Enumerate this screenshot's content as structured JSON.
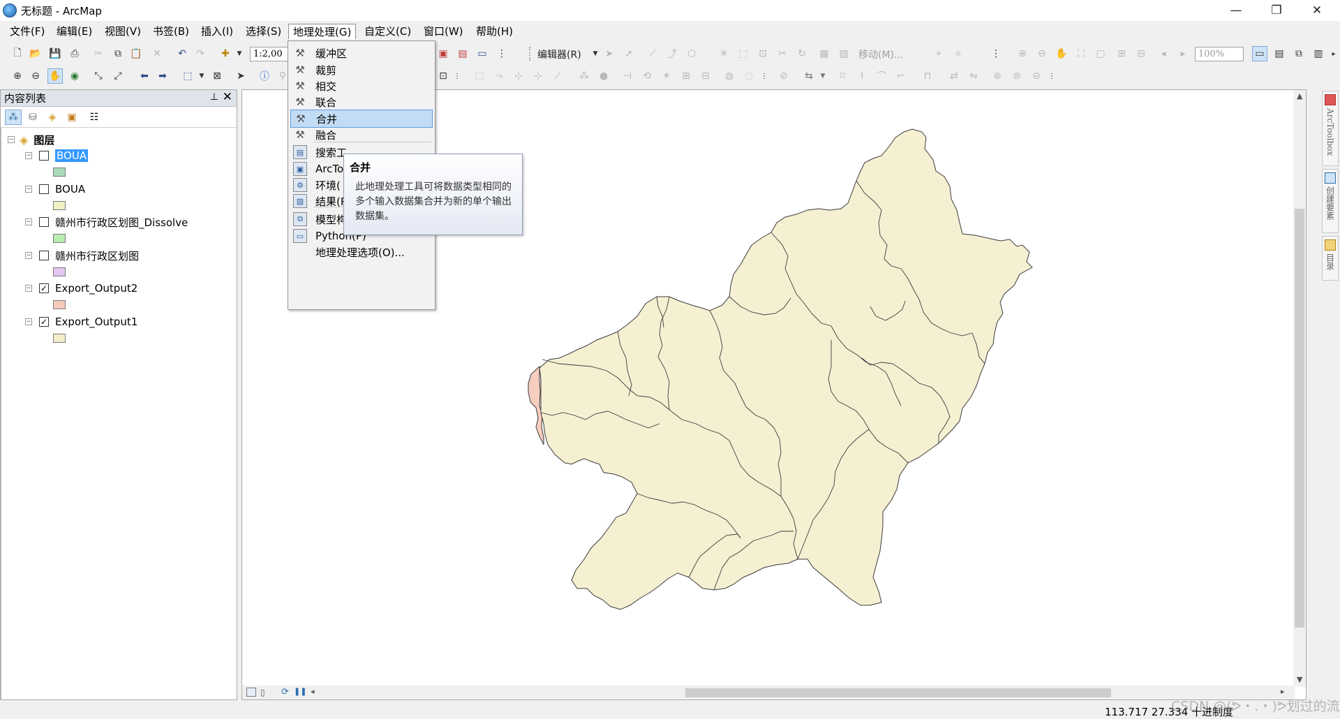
{
  "window": {
    "title": "无标题 - ArcMap",
    "controls": [
      "—",
      "❐",
      "✕"
    ]
  },
  "menubar": {
    "items": [
      "文件(F)",
      "编辑(E)",
      "视图(V)",
      "书签(B)",
      "插入(I)",
      "选择(S)",
      "地理处理(G)",
      "自定义(C)",
      "窗口(W)",
      "帮助(H)"
    ],
    "active": "地理处理(G)"
  },
  "toolbar": {
    "scale_value": "1:2,00",
    "editor_label": "编辑器(R)",
    "move_label": "移动(M)...",
    "zoom_value": "100%"
  },
  "toc": {
    "title": "内容列表",
    "root_label": "图层",
    "layers": [
      {
        "name": "BOUA",
        "checked": false,
        "selected": true,
        "color": "#a8dcb8"
      },
      {
        "name": "BOUA",
        "checked": false,
        "selected": false,
        "color": "#f1f0c6"
      },
      {
        "name": "赣州市行政区划图_Dissolve",
        "checked": false,
        "selected": false,
        "color": "#b9ecb0"
      },
      {
        "name": "赣州市行政区划图",
        "checked": false,
        "selected": false,
        "color": "#e3c6f1"
      },
      {
        "name": "Export_Output2",
        "checked": true,
        "selected": false,
        "color": "#f5cbb8"
      },
      {
        "name": "Export_Output1",
        "checked": true,
        "selected": false,
        "color": "#f5eecb"
      }
    ]
  },
  "geoprocessing_menu": {
    "items": [
      {
        "label": "缓冲区",
        "icon": "hammer-icon"
      },
      {
        "label": "裁剪",
        "icon": "hammer-icon"
      },
      {
        "label": "相交",
        "icon": "hammer-icon"
      },
      {
        "label": "联合",
        "icon": "hammer-icon"
      },
      {
        "label": "合并",
        "icon": "hammer-icon",
        "hover": true
      },
      {
        "label": "融合",
        "icon": "hammer-icon"
      },
      {
        "label": "搜索工",
        "icon": "search-window-icon"
      },
      {
        "label": "ArcTo",
        "icon": "toolbox-icon"
      },
      {
        "label": "环境(",
        "icon": "environment-icon"
      },
      {
        "label": "结果(R)",
        "icon": "results-icon"
      },
      {
        "label": "模型构建器(M)",
        "icon": "model-builder-icon"
      },
      {
        "label": "Python(P)",
        "icon": "python-window-icon"
      },
      {
        "label": "地理处理选项(O)...",
        "icon": ""
      }
    ]
  },
  "tooltip": {
    "title": "合并",
    "body": "此地理处理工具可将数据类型相同的多个输入数据集合并为新的单个输出数据集。"
  },
  "right_dock": {
    "tabs": [
      "ArcToolbox",
      "创建要素",
      "目录"
    ]
  },
  "map": {
    "fill_main": "#f6f0d3",
    "fill_edge": "#f7cdbf",
    "stroke": "#3a3a3a"
  },
  "status": {
    "coordinates": "113.717  27.334 十进制度",
    "watermark": "CSDN @(ᕗ・.・)ᕗ划过的流星"
  }
}
